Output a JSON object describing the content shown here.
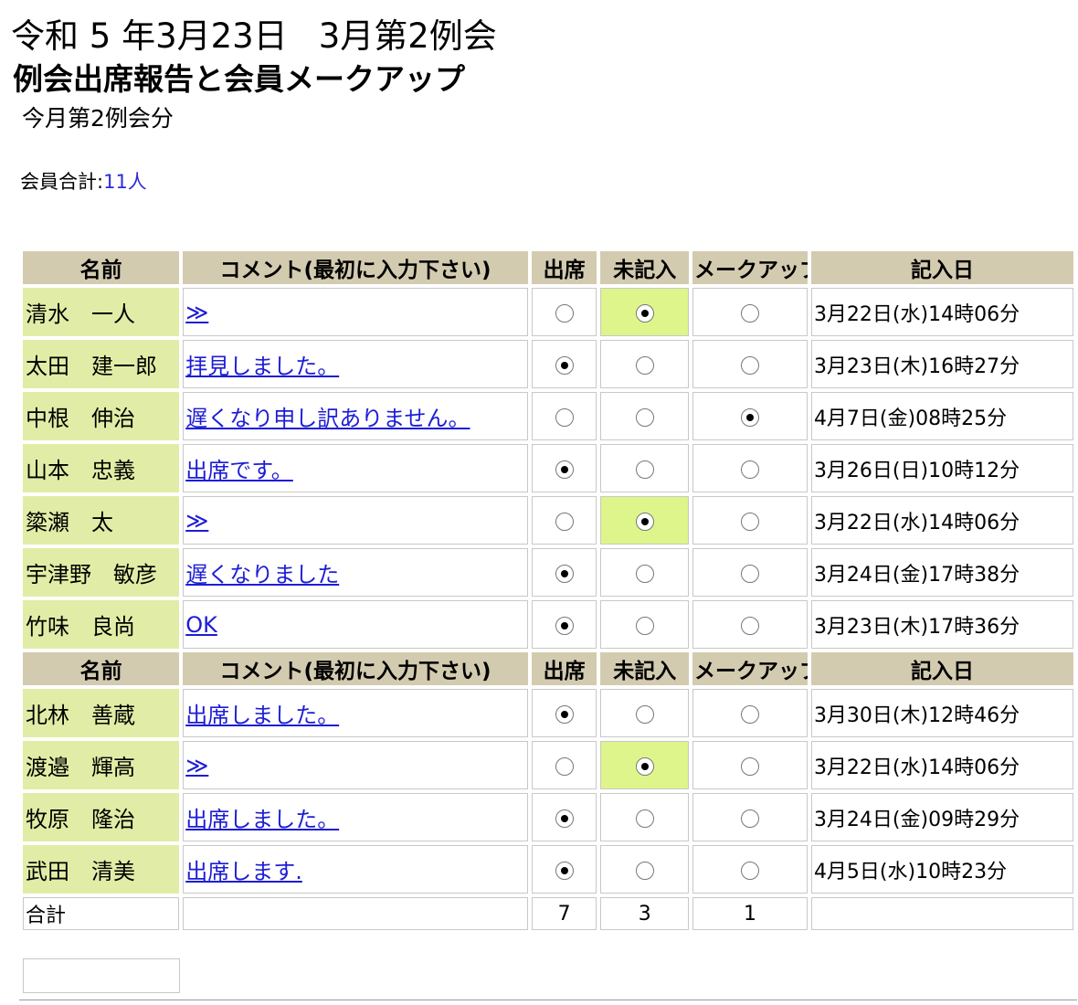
{
  "header": {
    "date": "令和 5 年3月23日",
    "meeting": "3月第2例会",
    "subtitle": "例会出席報告と会員メークアップ",
    "subtitle2": "今月第2例会分",
    "member_total_label": "会員合計:",
    "member_total_value": "11人"
  },
  "table": {
    "headers": {
      "name": "名前",
      "comment": "コメント(最初に入力下さい)",
      "attend": "出席",
      "blank": "未記入",
      "makeup": "メークアップ",
      "date": "記入日"
    },
    "groups": [
      [
        {
          "name": "清水　一人",
          "comment": "≫",
          "status": "blank",
          "date": "3月22日(水)14時06分"
        },
        {
          "name": "太田　建一郎",
          "comment": "拝見しました。",
          "status": "attend",
          "date": "3月23日(木)16時27分"
        },
        {
          "name": "中根　伸治",
          "comment": "遅くなり申し訳ありません。",
          "status": "makeup",
          "date": "4月7日(金)08時25分"
        },
        {
          "name": "山本　忠義",
          "comment": "出席です。",
          "status": "attend",
          "date": "3月26日(日)10時12分"
        },
        {
          "name": "簗瀬　太",
          "comment": "≫",
          "status": "blank",
          "date": "3月22日(水)14時06分"
        },
        {
          "name": "宇津野　敏彦",
          "comment": "遅くなりました",
          "status": "attend",
          "date": "3月24日(金)17時38分"
        },
        {
          "name": "竹味　良尚",
          "comment": "OK",
          "status": "attend",
          "date": "3月23日(木)17時36分"
        }
      ],
      [
        {
          "name": "北林　善蔵",
          "comment": "出席しました。",
          "status": "attend",
          "date": "3月30日(木)12時46分"
        },
        {
          "name": "渡邉　輝高",
          "comment": "≫",
          "status": "blank",
          "date": "3月22日(水)14時06分"
        },
        {
          "name": "牧原　隆治",
          "comment": "出席しました。",
          "status": "attend",
          "date": "3月24日(金)09時29分"
        },
        {
          "name": "武田　清美",
          "comment": "出席します.",
          "status": "attend",
          "date": "4月5日(水)10時23分"
        }
      ]
    ],
    "totals": {
      "label": "合計",
      "attend": "7",
      "blank": "3",
      "makeup": "1"
    }
  },
  "colors": {
    "header_bg": "#d3cbb0",
    "name_bg": "#e1eda6",
    "attend_selected": "#c4c4f8",
    "blank_selected": "#def58c",
    "makeup_selected": "#d76582",
    "link": "#1d1dd6"
  }
}
